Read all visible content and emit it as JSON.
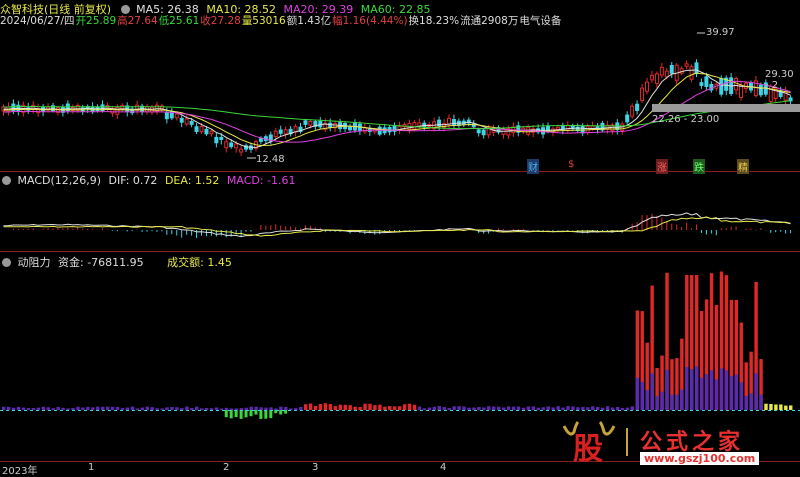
{
  "header": {
    "stock_name": "众智科技",
    "adj_mode": "(日线 前复权)",
    "ma": [
      {
        "label": "MA5: 26.38",
        "color": "#e0e0e0"
      },
      {
        "label": "MA10: 28.52",
        "color": "#e8e84a"
      },
      {
        "label": "MA20: 29.39",
        "color": "#e040e0"
      },
      {
        "label": "MA60: 22.85",
        "color": "#3ad83a"
      }
    ]
  },
  "quote": {
    "date": "2024/06/27/四",
    "open": "开25.89",
    "high": "高27.64",
    "low": "低25.61",
    "close": "收27.28",
    "volume": "量53016",
    "amount": "额1.43亿",
    "change": "幅1.16(4.44%)",
    "turnover": "换18.23%",
    "float": "流通2908万",
    "industry": "电气设备"
  },
  "main_chart": {
    "annotations": {
      "high": "39.97",
      "low": "12.48",
      "right_price": "29.30 - 2",
      "band": "22.26 - 23.00"
    },
    "event_tags": [
      {
        "label": "财",
        "color": "#4ab4e8"
      },
      {
        "label": "$",
        "color": "#e04040"
      },
      {
        "label": "涨",
        "color": "#e04040"
      },
      {
        "label": "跌",
        "color": "#3ad83a"
      },
      {
        "label": "精",
        "color": "#e8c84a"
      }
    ]
  },
  "macd_panel": {
    "title": "MACD(12,26,9)",
    "dif": "DIF: 0.72",
    "dea": "DEA: 1.52",
    "macd": "MACD: -1.61"
  },
  "flow_panel": {
    "title": "动阻力",
    "fund": "资金: -76811.95",
    "turnover_amt": "成交额: 1.45"
  },
  "x_axis": {
    "labels": [
      "2023年",
      "1",
      "2",
      "3",
      "4"
    ]
  },
  "watermark": {
    "logo_char": "股",
    "site_name": "公式之家",
    "url": "www.gszj100.com"
  },
  "colors": {
    "up": "#e02828",
    "down": "#3fd4e6",
    "ma5": "#e0e0e0",
    "ma10": "#e8e84a",
    "ma20": "#e040e0",
    "ma60": "#3ad83a",
    "fund": "#5a2bb0"
  }
}
